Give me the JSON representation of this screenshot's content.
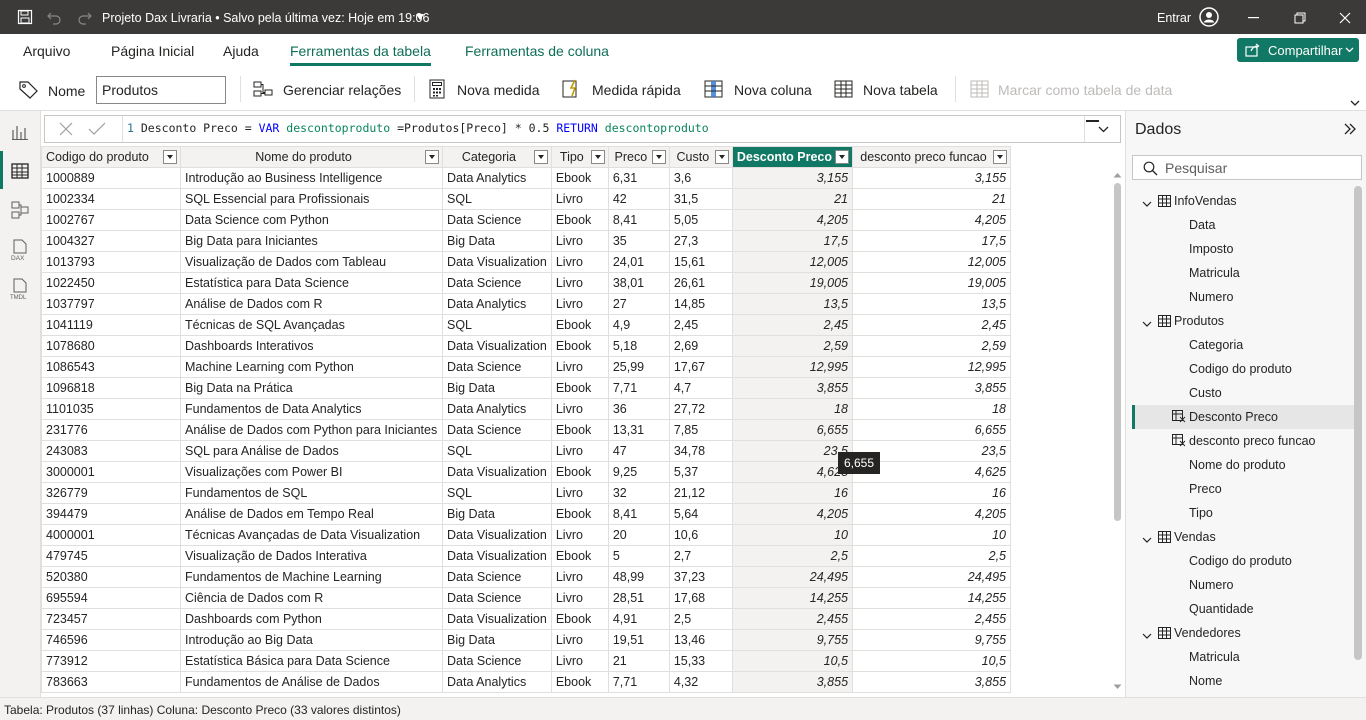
{
  "titlebar": {
    "title": "Projeto Dax Livraria • Salvo pela última vez: Hoje em 19:06",
    "signin": "Entrar"
  },
  "tabs": {
    "arquivo": "Arquivo",
    "inicio": "Página Inicial",
    "ajuda": "Ajuda",
    "ferr_tabela": "Ferramentas da tabela",
    "ferr_coluna": "Ferramentas de coluna",
    "share": "Compartilhar"
  },
  "ribbon": {
    "name_label": "Nome",
    "name_value": "Produtos",
    "manage_rel": "Gerenciar relações",
    "new_measure": "Nova medida",
    "quick_measure": "Medida rápida",
    "new_column": "Nova coluna",
    "new_table": "Nova tabela",
    "mark_date": "Marcar como tabela de data"
  },
  "formula": {
    "line": "1",
    "p1": "Desconto Preco = ",
    "p2": "VAR",
    "p3": " descontoproduto ",
    "p4": "=Produtos[Preco] * 0.5 ",
    "p5": "RETURN",
    "p6": " descontoproduto"
  },
  "table": {
    "headers": [
      "Codigo do produto",
      "Nome do produto",
      "Categoria",
      "Tipo",
      "Preco",
      "Custo",
      "Desconto Preco",
      "desconto preco funcao"
    ],
    "rows": [
      [
        "1000889",
        "Introdução ao Business Intelligence",
        "Data Analytics",
        "Ebook",
        "6,31",
        "3,6",
        "3,155",
        "3,155"
      ],
      [
        "1002334",
        "SQL Essencial para Profissionais",
        "SQL",
        "Livro",
        "42",
        "31,5",
        "21",
        "21"
      ],
      [
        "1002767",
        "Data Science com Python",
        "Data Science",
        "Ebook",
        "8,41",
        "5,05",
        "4,205",
        "4,205"
      ],
      [
        "1004327",
        "Big Data para Iniciantes",
        "Big Data",
        "Livro",
        "35",
        "27,3",
        "17,5",
        "17,5"
      ],
      [
        "1013793",
        "Visualização de Dados com Tableau",
        "Data Visualization",
        "Livro",
        "24,01",
        "15,61",
        "12,005",
        "12,005"
      ],
      [
        "1022450",
        "Estatística para Data Science",
        "Data Science",
        "Livro",
        "38,01",
        "26,61",
        "19,005",
        "19,005"
      ],
      [
        "1037797",
        "Análise de Dados com R",
        "Data Analytics",
        "Livro",
        "27",
        "14,85",
        "13,5",
        "13,5"
      ],
      [
        "1041119",
        "Técnicas de SQL Avançadas",
        "SQL",
        "Ebook",
        "4,9",
        "2,45",
        "2,45",
        "2,45"
      ],
      [
        "1078680",
        "Dashboards Interativos",
        "Data Visualization",
        "Ebook",
        "5,18",
        "2,69",
        "2,59",
        "2,59"
      ],
      [
        "1086543",
        "Machine Learning com Python",
        "Data Science",
        "Livro",
        "25,99",
        "17,67",
        "12,995",
        "12,995"
      ],
      [
        "1096818",
        "Big Data na Prática",
        "Big Data",
        "Ebook",
        "7,71",
        "4,7",
        "3,855",
        "3,855"
      ],
      [
        "1101035",
        "Fundamentos de Data Analytics",
        "Data Analytics",
        "Livro",
        "36",
        "27,72",
        "18",
        "18"
      ],
      [
        "231776",
        "Análise de Dados com Python para Iniciantes",
        "Data Science",
        "Ebook",
        "13,31",
        "7,85",
        "6,655",
        "6,655"
      ],
      [
        "243083",
        "SQL para Análise de Dados",
        "SQL",
        "Livro",
        "47",
        "34,78",
        "23,5",
        "23,5"
      ],
      [
        "3000001",
        "Visualizações com Power BI",
        "Data Visualization",
        "Ebook",
        "9,25",
        "5,37",
        "4,625",
        "4,625"
      ],
      [
        "326779",
        "Fundamentos de SQL",
        "SQL",
        "Livro",
        "32",
        "21,12",
        "16",
        "16"
      ],
      [
        "394479",
        "Análise de Dados em Tempo Real",
        "Big Data",
        "Ebook",
        "8,41",
        "5,64",
        "4,205",
        "4,205"
      ],
      [
        "4000001",
        "Técnicas Avançadas de Data Visualization",
        "Data Visualization",
        "Livro",
        "20",
        "10,6",
        "10",
        "10"
      ],
      [
        "479745",
        "Visualização de Dados Interativa",
        "Data Visualization",
        "Ebook",
        "5",
        "2,7",
        "2,5",
        "2,5"
      ],
      [
        "520380",
        "Fundamentos de Machine Learning",
        "Data Science",
        "Livro",
        "48,99",
        "37,23",
        "24,495",
        "24,495"
      ],
      [
        "695594",
        "Ciência de Dados com R",
        "Data Science",
        "Livro",
        "28,51",
        "17,68",
        "14,255",
        "14,255"
      ],
      [
        "723457",
        "Dashboards com Python",
        "Data Visualization",
        "Ebook",
        "4,91",
        "2,5",
        "2,455",
        "2,455"
      ],
      [
        "746596",
        "Introdução ao Big Data",
        "Big Data",
        "Livro",
        "19,51",
        "13,46",
        "9,755",
        "9,755"
      ],
      [
        "773912",
        "Estatística Básica para Data Science",
        "Data Science",
        "Livro",
        "21",
        "15,33",
        "10,5",
        "10,5"
      ],
      [
        "783663",
        "Fundamentos de Análise de Dados",
        "Data Analytics",
        "Ebook",
        "7,71",
        "4,32",
        "3,855",
        "3,855"
      ]
    ]
  },
  "tooltip": "6,655",
  "pane": {
    "title": "Dados",
    "search_placeholder": "Pesquisar",
    "tree": [
      {
        "label": "InfoVendas",
        "kind": "table"
      },
      {
        "label": "Data",
        "kind": "field"
      },
      {
        "label": "Imposto",
        "kind": "field"
      },
      {
        "label": "Matricula",
        "kind": "field"
      },
      {
        "label": "Numero",
        "kind": "field"
      },
      {
        "label": "Produtos",
        "kind": "table"
      },
      {
        "label": "Categoria",
        "kind": "field"
      },
      {
        "label": "Codigo do produto",
        "kind": "field"
      },
      {
        "label": "Custo",
        "kind": "field"
      },
      {
        "label": "Desconto Preco",
        "kind": "calc",
        "selected": true
      },
      {
        "label": "desconto preco funcao",
        "kind": "calc"
      },
      {
        "label": "Nome do produto",
        "kind": "field"
      },
      {
        "label": "Preco",
        "kind": "field"
      },
      {
        "label": "Tipo",
        "kind": "field"
      },
      {
        "label": "Vendas",
        "kind": "table"
      },
      {
        "label": "Codigo do produto",
        "kind": "field"
      },
      {
        "label": "Numero",
        "kind": "field"
      },
      {
        "label": "Quantidade",
        "kind": "field"
      },
      {
        "label": "Vendedores",
        "kind": "table"
      },
      {
        "label": "Matricula",
        "kind": "field"
      },
      {
        "label": "Nome",
        "kind": "field"
      }
    ]
  },
  "status": "Tabela: Produtos (37 linhas) Coluna: Desconto Preco (33 valores distintos)",
  "colors": {
    "accent": "#117865",
    "titlebar": "#3b3a39"
  }
}
